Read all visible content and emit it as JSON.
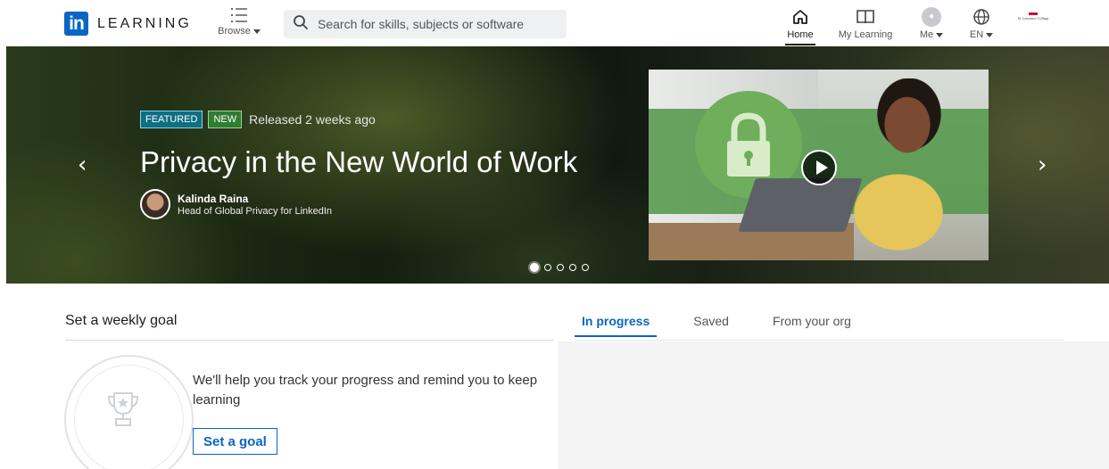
{
  "header": {
    "logo_mark": "in",
    "logo_text": "LEARNING",
    "browse_label": "Browse",
    "search_placeholder": "Search for skills, subjects or software",
    "nav": {
      "home": "Home",
      "my_learning": "My Learning",
      "me": "Me",
      "language": "EN"
    },
    "college_text": "St. Lawrence College"
  },
  "hero": {
    "badges": {
      "featured": "FEATURED",
      "new": "NEW"
    },
    "released": "Released 2 weeks ago",
    "title": "Privacy in the New World of Work",
    "author": {
      "name": "Kalinda Raina",
      "role": "Head of Global Privacy for LinkedIn"
    },
    "prev_glyph": "‹",
    "next_glyph": "›",
    "slide_count": 5,
    "active_slide": 1
  },
  "goal": {
    "heading": "Set a weekly goal",
    "text": "We'll help you track your progress and remind you to keep learning",
    "button": "Set a goal"
  },
  "tabs": [
    {
      "label": "In progress",
      "active": true
    },
    {
      "label": "Saved",
      "active": false
    },
    {
      "label": "From your org",
      "active": false
    }
  ],
  "colors": {
    "brand": "#0a66c2",
    "featured": "#0f6e82",
    "new": "#2e7d32"
  },
  "icons": [
    "browse-list-icon",
    "search-icon",
    "home-icon",
    "book-icon",
    "globe-icon",
    "trophy-icon",
    "play-icon"
  ]
}
